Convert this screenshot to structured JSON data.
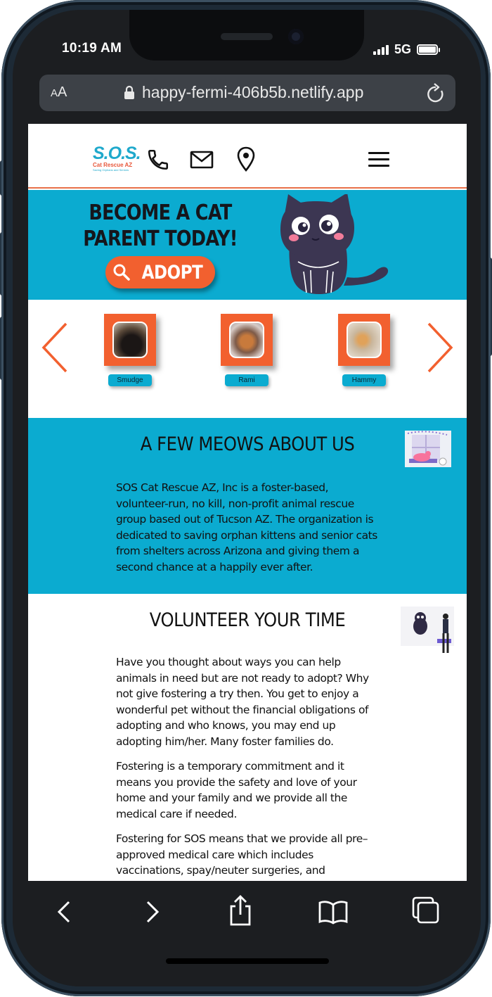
{
  "status_bar": {
    "time": "10:19 AM",
    "network": "5G"
  },
  "browser": {
    "text_size_label": "AA",
    "url": "happy-fermi-406b5b.netlify.app"
  },
  "site": {
    "logo": {
      "name": "S.O.S.",
      "subtitle": "Cat Rescue AZ",
      "tagline": "Saving Orphans and Seniors"
    },
    "header_icons": [
      "phone-icon",
      "mail-icon",
      "location-pin-icon",
      "hamburger-menu-icon"
    ],
    "hero": {
      "title": "BECOME A CAT PARENT TODAY!",
      "adopt_label": "ADOPT"
    },
    "carousel": {
      "pets": [
        "Smudge",
        "Rami",
        "Hammy"
      ]
    },
    "about": {
      "title": "A FEW MEOWS ABOUT US",
      "text": "SOS Cat Rescue AZ, Inc is a foster-based, volunteer-run, no kill, non-profit animal rescue group based out of Tucson AZ. The organization is dedicated to saving orphan kittens and senior cats from shelters across Arizona and giving them a second chance at a happily ever after."
    },
    "volunteer": {
      "title": "VOLUNTEER YOUR TIME",
      "paragraphs": [
        "Have you thought about ways you can help animals in need but are not ready to adopt? Why not give fostering a try then. You get to enjoy a wonderful pet without the financial obligations of adopting and who knows, you may end up adopting him/her. Many foster families do.",
        "Fostering is a temporary commitment and it means you provide the safety and love of your home and your family and we provide all the medical care if needed.",
        "Fostering for SOS means that we provide all pre–approved medical care which includes vaccinations, spay/neuter surgeries, and treatment for any medical issues that the cat is experiencing."
      ]
    }
  },
  "colors": {
    "accent_orange": "#f2602f",
    "brand_teal": "#0babd0",
    "chrome_dark": "#1c1e21"
  }
}
